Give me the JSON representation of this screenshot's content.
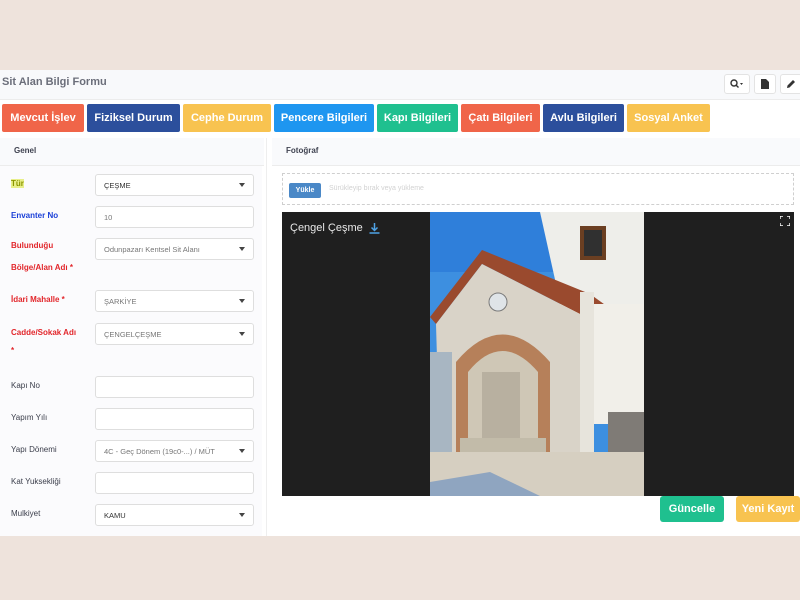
{
  "header": {
    "title": "Sit Alan Bilgi Formu"
  },
  "tabs": [
    {
      "label": "Mevcut İşlev",
      "color": "#f06549"
    },
    {
      "label": "Fiziksel Durum",
      "color": "#2c4f9c"
    },
    {
      "label": "Cephe Durum",
      "color": "#f8c350"
    },
    {
      "label": "Pencere Bilgileri",
      "color": "#1e96f0"
    },
    {
      "label": "Kapı Bilgileri",
      "color": "#1fc08f"
    },
    {
      "label": "Çatı Bilgileri",
      "color": "#f06549"
    },
    {
      "label": "Avlu Bilgileri",
      "color": "#2c4f9c"
    },
    {
      "label": "Sosyal Anket",
      "color": "#f8c350"
    }
  ],
  "sections": {
    "left": "Genel",
    "right": "Fotoğraf"
  },
  "form": {
    "tur_label": "Tür",
    "tur_value": "ÇEŞME",
    "envanter_label": "Envanter No",
    "envanter_value": "10",
    "bolge_label_1": "Bulunduğu",
    "bolge_label_2": "Bölge/Alan Adı *",
    "bolge_value": "Odunpazarı Kentsel Sit Alanı",
    "mahalle_label": "İdari Mahalle *",
    "mahalle_value": "ŞARKİYE",
    "cadde_label_1": "Cadde/Sokak Adı",
    "cadde_label_2": "*",
    "cadde_value": "ÇENGELÇEŞME",
    "kapi_label": "Kapı No",
    "kapi_value": "",
    "yapim_label": "Yapım Yılı",
    "yapim_value": "",
    "donem_label": "Yapı Dönemi",
    "donem_value": "4C - Geç Dönem (19c0-...) / MÜT",
    "kat_label": "Kat Yuksekliği",
    "kat_value": "",
    "mulkiyet_label": "Mulkiyet",
    "mulkiyet_value": "KAMU"
  },
  "upload": {
    "button_label": "Yükle",
    "hint": "Sürükleyip bırak veya yükleme"
  },
  "photo": {
    "caption": "Çengel Çeşme"
  },
  "actions": {
    "update_label": "Güncelle",
    "update_color": "#1fc08f",
    "new_label": "Yeni Kayıt",
    "new_color": "#f8c350"
  },
  "colors": {
    "label_highlight": "#c9d900",
    "label_blue": "#1b40d8",
    "label_red": "#e2262b",
    "label_default": "#3a3d4a"
  }
}
